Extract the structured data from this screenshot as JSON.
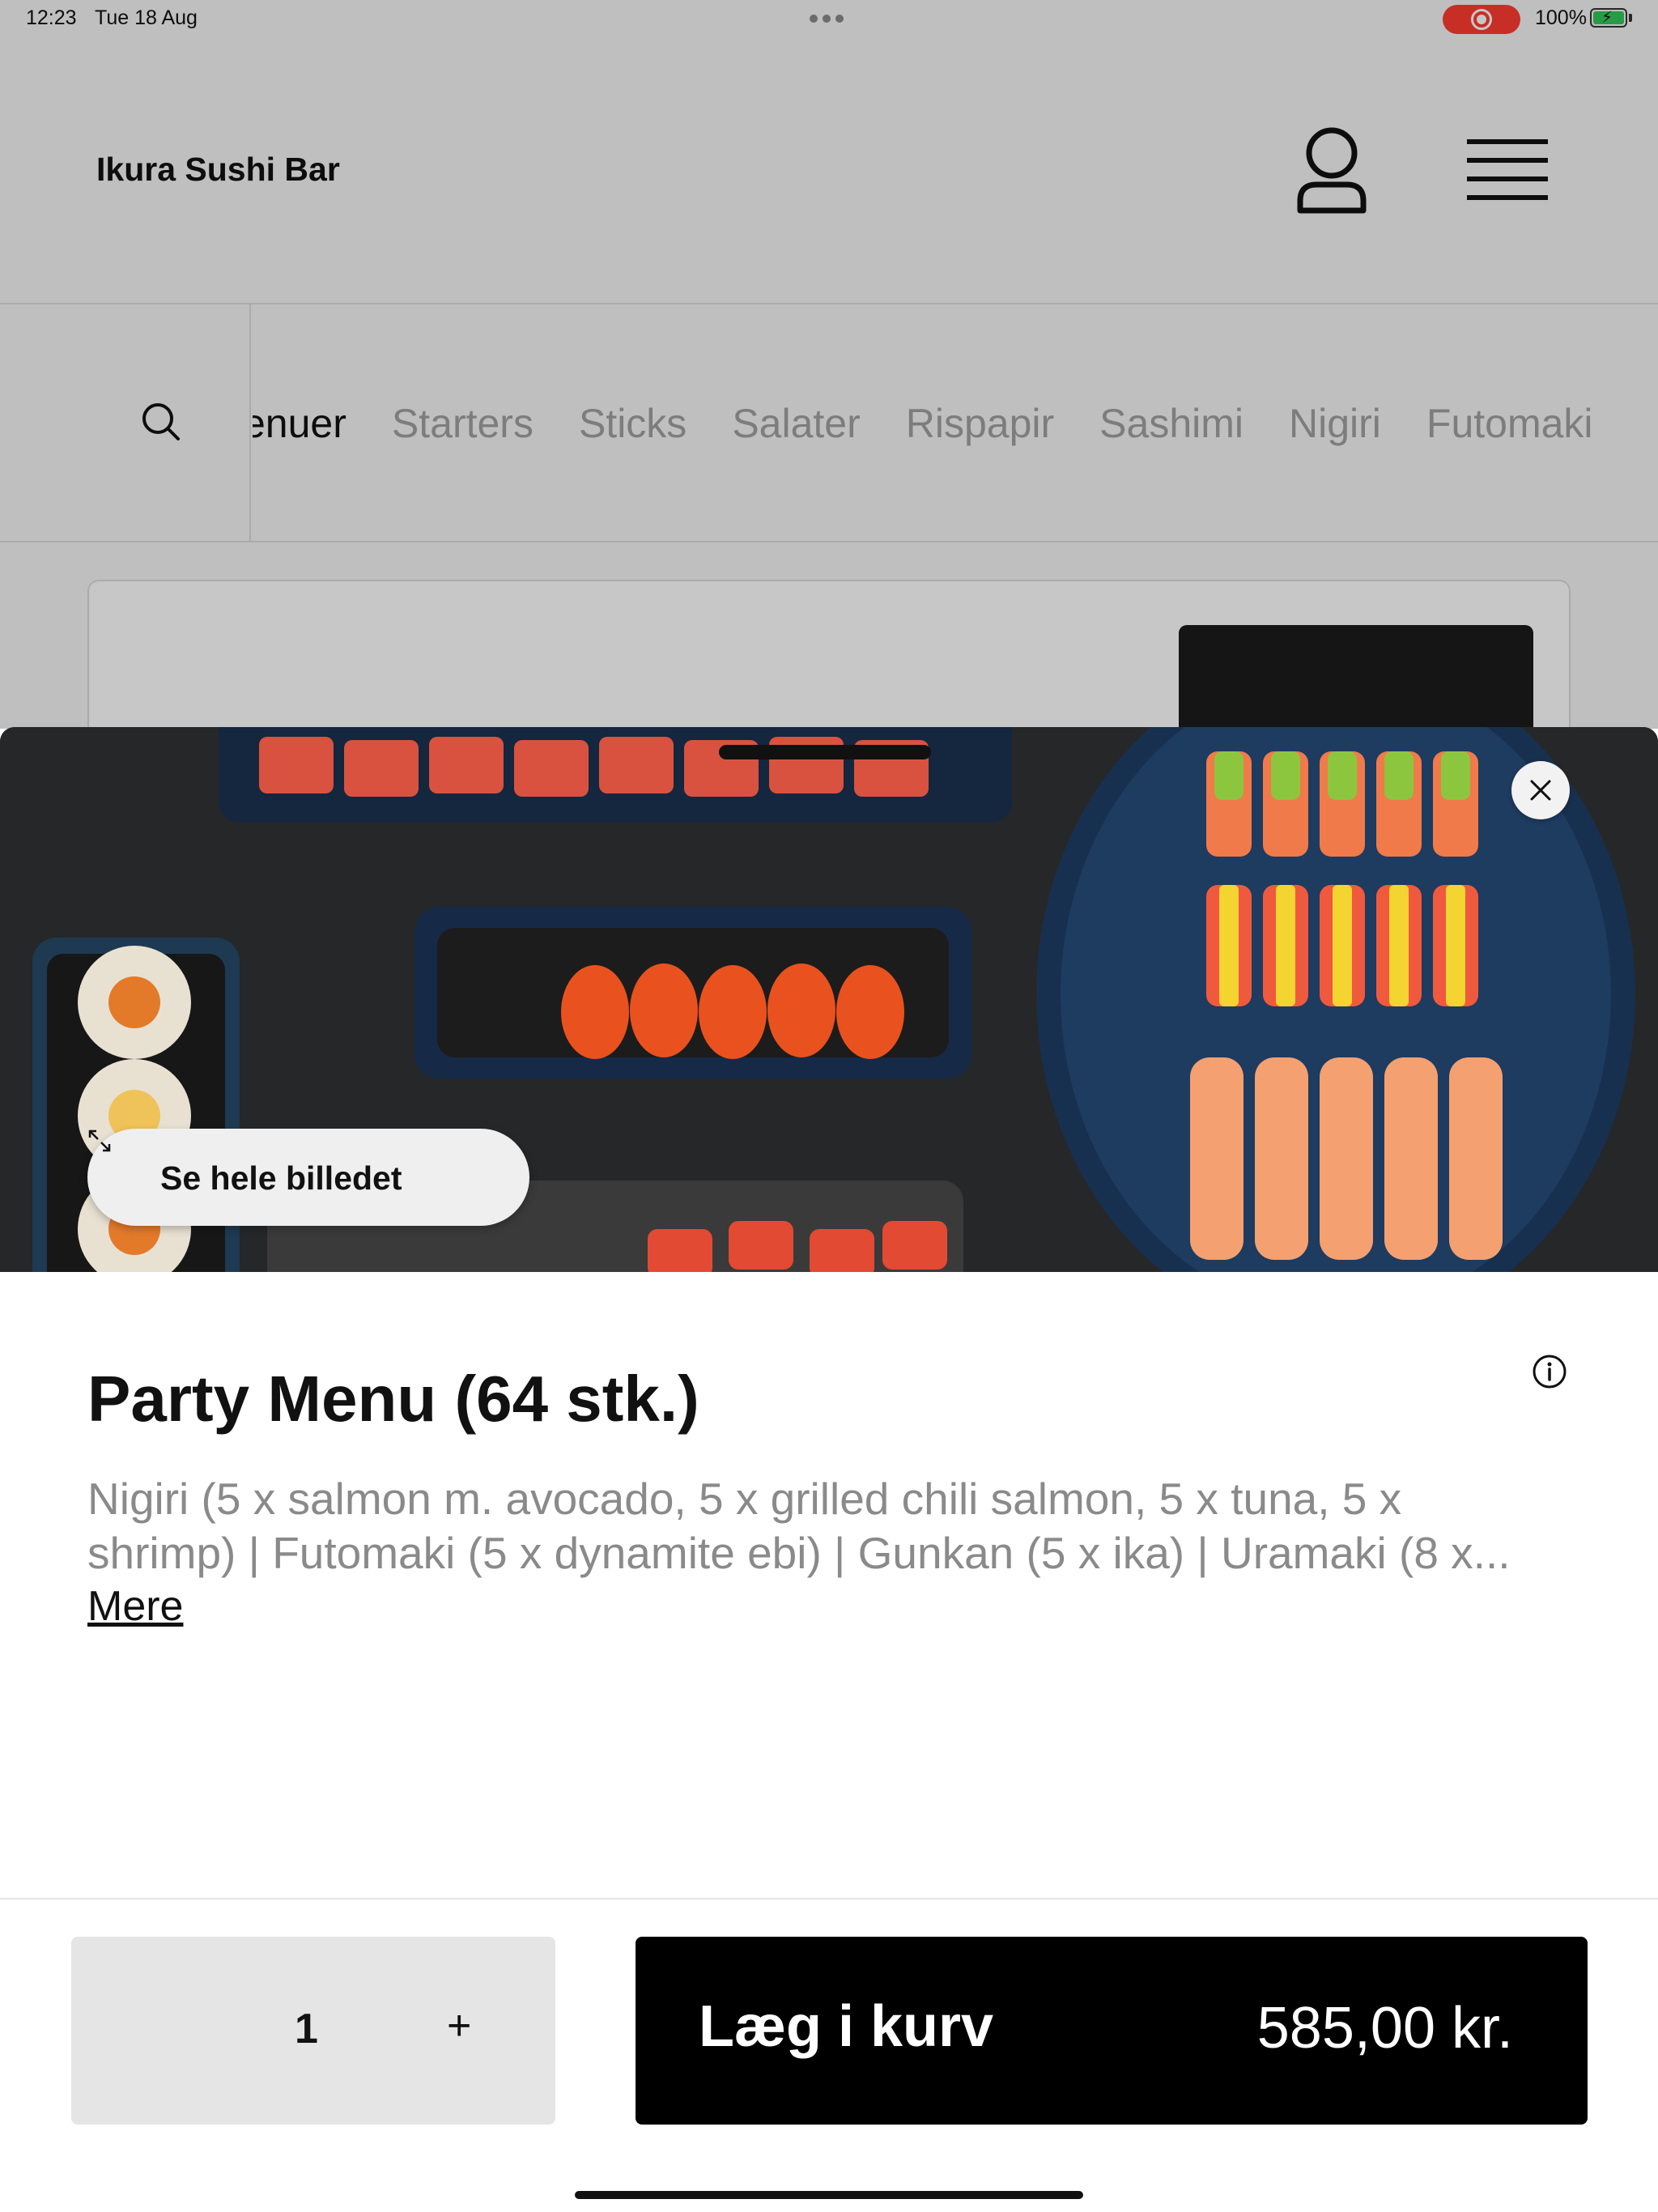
{
  "status_bar": {
    "time": "12:23",
    "date": "Tue 18 Aug",
    "battery": "100%"
  },
  "header": {
    "restaurant_name": "Ikura Sushi Bar"
  },
  "categories": {
    "active": "enuer",
    "items": [
      "Starters",
      "Sticks",
      "Salater",
      "Rispapir",
      "Sashimi",
      "Nigiri",
      "Futomaki"
    ]
  },
  "product": {
    "view_image_label": "Se hele billedet",
    "title": "Party Menu (64 stk.)",
    "description_lines": [
      "Nigiri (5 x salmon m. avocado, 5 x grilled chili salmon, 5 x tuna, 5 x",
      "shrimp) | Futomaki (5 x dynamite ebi) | Gunkan (5 x ika) | Uramaki (8 x..."
    ],
    "more_label": "Mere"
  },
  "footer": {
    "quantity": "1",
    "plus": "+",
    "add_to_cart_label": "Læg i kurv",
    "price": "585,00 kr."
  },
  "colors": {
    "accent_button": "#000000",
    "recording_indicator": "#ff3b30",
    "battery_fill": "#34c759",
    "muted_text": "#8a8a8a"
  },
  "icons": {
    "profile": "person-icon",
    "menu": "hamburger-icon",
    "search": "search-icon",
    "close": "close-icon",
    "expand": "expand-icon",
    "info": "info-icon"
  }
}
